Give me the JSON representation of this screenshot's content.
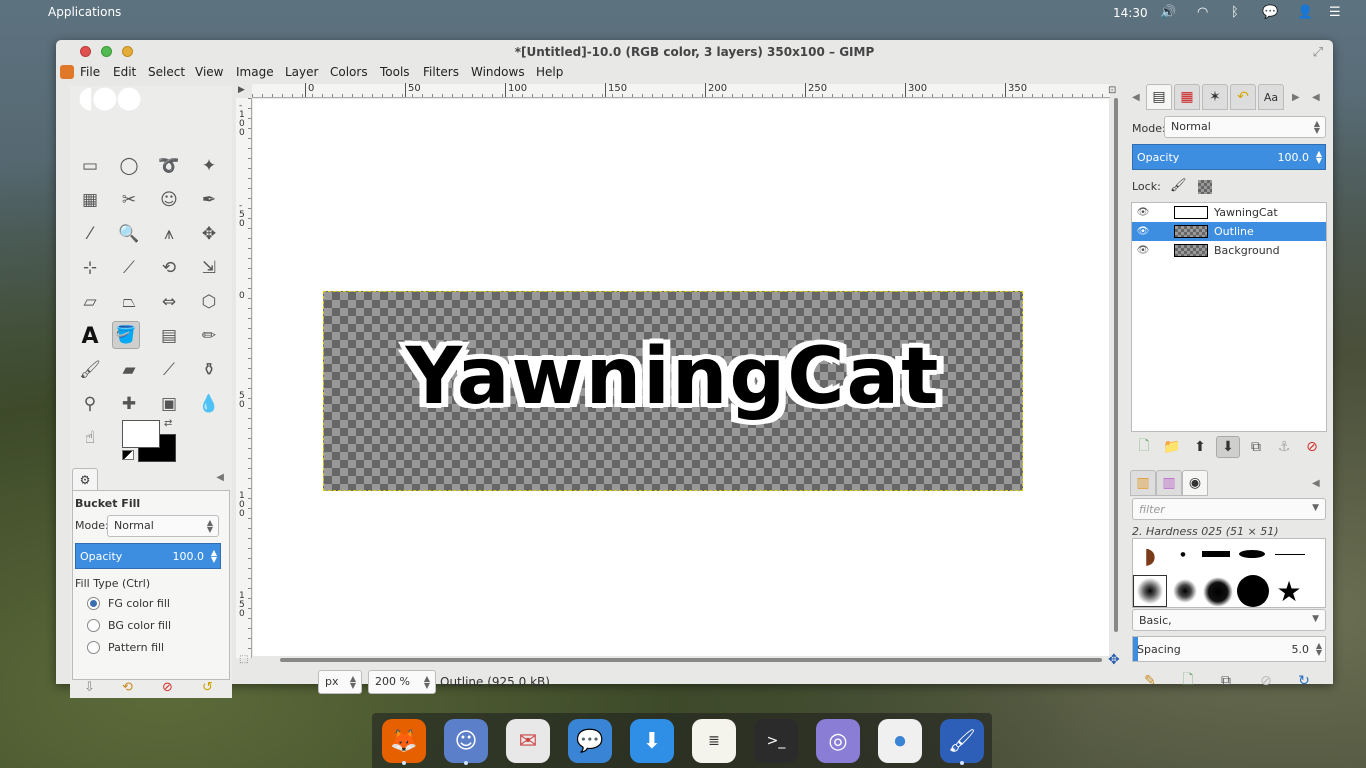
{
  "top_panel": {
    "applications_label": "Applications",
    "clock": "14:30",
    "indicators": [
      "volume-icon",
      "wifi-icon",
      "bluetooth-icon",
      "chat-icon",
      "user-icon",
      "menu-icon"
    ]
  },
  "window": {
    "title": "*[Untitled]-10.0 (RGB color, 3 layers) 350x100 – GIMP"
  },
  "menubar": {
    "items": [
      "File",
      "Edit",
      "Select",
      "View",
      "Image",
      "Layer",
      "Colors",
      "Tools",
      "Filters",
      "Windows",
      "Help"
    ]
  },
  "toolbox": {
    "tools": [
      "rect-select-icon",
      "ellipse-select-icon",
      "lasso-icon",
      "fuzzy-select-icon",
      "select-by-color-icon",
      "scissors-icon",
      "foreground-select-icon",
      "paths-icon",
      "color-picker-icon",
      "zoom-icon",
      "measure-icon",
      "move-icon",
      "align-icon",
      "crop-icon",
      "rotate-icon",
      "scale-icon",
      "shear-icon",
      "perspective-icon",
      "flip-icon",
      "cage-transform-icon",
      "text-icon",
      "bucket-fill-icon",
      "blend-icon",
      "pencil-icon",
      "paintbrush-icon",
      "eraser-icon",
      "airbrush-icon",
      "ink-icon",
      "clone-icon",
      "heal-icon",
      "perspective-clone-icon",
      "blur-icon",
      "smudge-icon",
      "dodge-burn-icon"
    ],
    "active_tool": "bucket-fill-icon",
    "fg_color": "#ffffff",
    "bg_color": "#000000"
  },
  "tool_options": {
    "title": "Bucket Fill",
    "mode_label": "Mode:",
    "mode_value": "Normal",
    "opacity_label": "Opacity",
    "opacity_value": "100.0",
    "fill_type_label": "Fill Type  (Ctrl)",
    "fill_types": [
      "FG color fill",
      "BG color fill",
      "Pattern fill"
    ],
    "selected_fill": 0
  },
  "ruler": {
    "h_ticks": [
      "0",
      "50",
      "100",
      "150",
      "200",
      "250",
      "300",
      "350"
    ],
    "v_ticks": [
      "-100",
      "-50",
      "0",
      "50",
      "100",
      "150"
    ]
  },
  "canvas": {
    "logo_text": "YawningCat"
  },
  "statusbar": {
    "unit": "px",
    "zoom": "200 %",
    "status": "Outline (925.0 kB)"
  },
  "layers_dock": {
    "mode_label": "Mode:",
    "mode_value": "Normal",
    "opacity_label": "Opacity",
    "opacity_value": "100.0",
    "lock_label": "Lock:",
    "layers": [
      {
        "name": "YawningCat",
        "selected": false
      },
      {
        "name": "Outline",
        "selected": true
      },
      {
        "name": "Background",
        "selected": false
      }
    ]
  },
  "brushes_dock": {
    "filter_placeholder": "filter",
    "brush_name": "2. Hardness 025 (51 × 51)",
    "preset": "Basic,",
    "spacing_label": "Spacing",
    "spacing_value": "5.0"
  },
  "colors": {
    "accent": "#3d8ee0",
    "selection_border": "#d7c800"
  }
}
